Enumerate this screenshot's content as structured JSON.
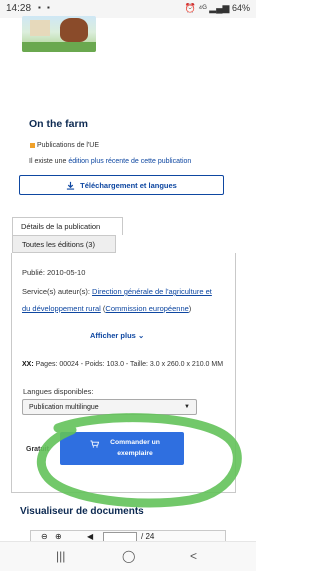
{
  "statusbar": {
    "time": "14:28",
    "battery": "64%",
    "left_icons": "▪ ▪",
    "right_icons": "⏰ ⁴ᴳ"
  },
  "publication": {
    "title": "On the farm",
    "publisher_badge": "Publications de l'UE",
    "edition_prefix": "Il existe une ",
    "edition_link": "édition plus récente de cette publication",
    "download_label": "Téléchargement et langues"
  },
  "tabs": {
    "details": "Détails de la publication",
    "all_editions": "Toutes les éditions (3)"
  },
  "details": {
    "published": "Publié: 2010-05-10",
    "service_prefix": "Service(s) auteur(s): ",
    "service_link_1": "Direction générale de l'agriculture et du développement rural",
    "service_sep": " (",
    "service_link_2": "Commission européenne",
    "service_suffix": ")",
    "show_more": "Afficher plus",
    "format_key": "XX:",
    "format_text": " Pages: 00024 - Poids: 103.0 - Taille: 3.0 x 260.0 x 210.0 MM",
    "languages_label": "Langues disponibles:",
    "language_selected": "Publication multilingue",
    "free_label": "Gratuit",
    "order_label": "Commander un exemplaire"
  },
  "viewer": {
    "title": "Visualiseur de documents",
    "page_hint": "/ 24"
  },
  "colors": {
    "primary": "#2f6fe0",
    "link": "#0e47a1",
    "badge": "#f0a12a",
    "annotation": "#63c25a"
  },
  "icons": {
    "download": "download-icon",
    "chevron": "chevron-down-icon",
    "cart": "cart-icon",
    "nav_recent": "recent-apps-icon",
    "nav_home": "home-icon",
    "nav_back": "back-icon"
  }
}
